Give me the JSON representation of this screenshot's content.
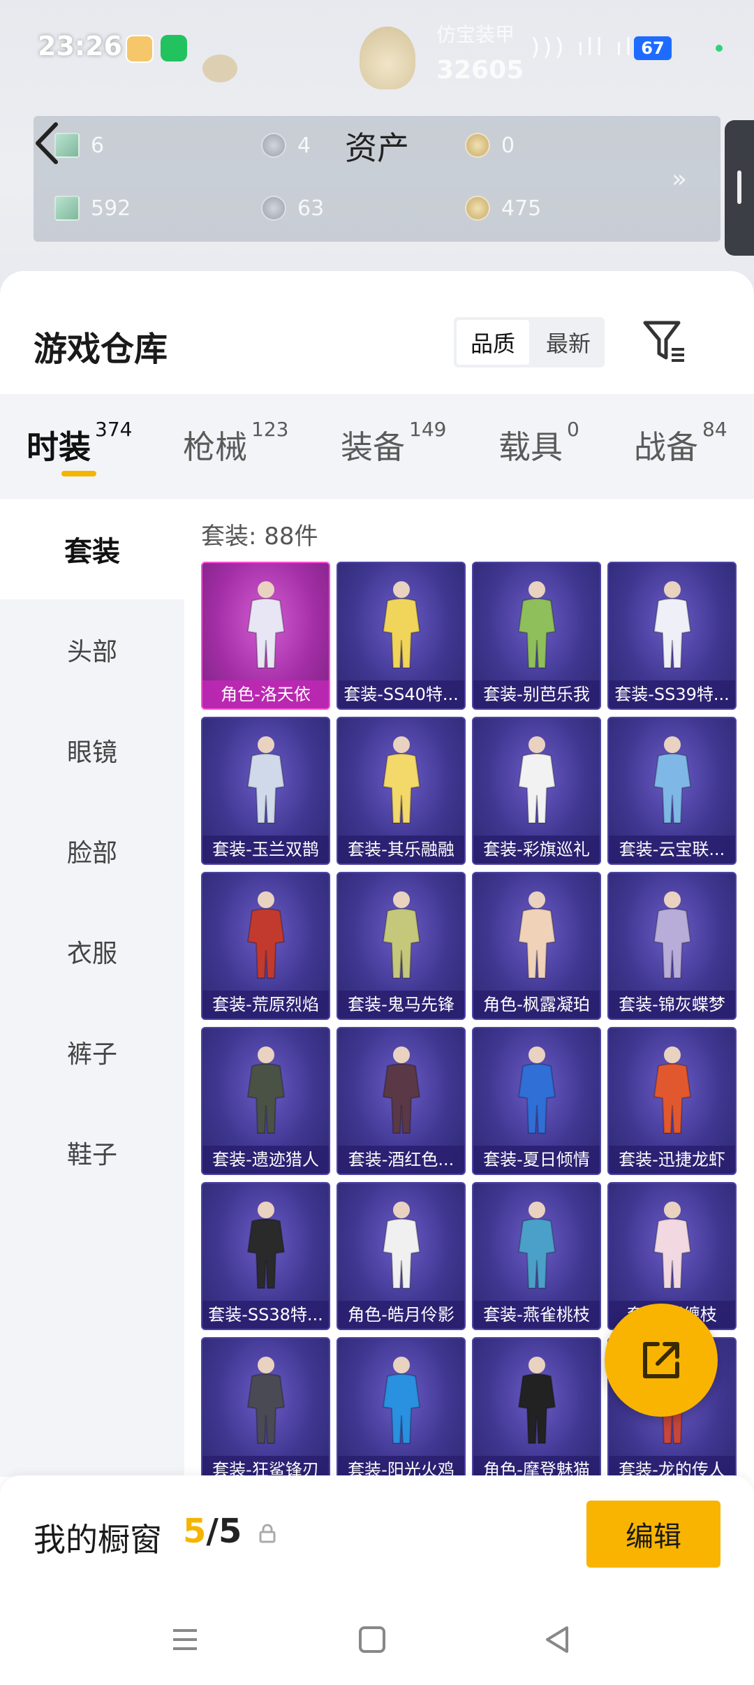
{
  "status_bar": {
    "time": "23:26",
    "battery": "67",
    "blur_title": "仿宝装甲",
    "blur_number": "32605",
    "signal": "))) ıll ıll"
  },
  "assets": {
    "title": "资产",
    "cells": [
      {
        "icon": "card-icon",
        "value": "6"
      },
      {
        "icon": "coin-silver-icon",
        "value": "4"
      },
      {
        "icon": "coin-gold-icon",
        "value": "0"
      },
      {
        "icon": "ticket-icon",
        "value": "592"
      },
      {
        "icon": "coin-silver-icon",
        "value": "63"
      },
      {
        "icon": "coin-gold-icon",
        "value": "475"
      }
    ],
    "more": "»"
  },
  "warehouse": {
    "title": "游戏仓库",
    "sort": {
      "quality": "品质",
      "newest": "最新"
    }
  },
  "tabs": [
    {
      "label": "时装",
      "count": "374"
    },
    {
      "label": "枪械",
      "count": "123"
    },
    {
      "label": "装备",
      "count": "149"
    },
    {
      "label": "载具",
      "count": "0"
    },
    {
      "label": "战备",
      "count": "84"
    }
  ],
  "side_nav": [
    "套装",
    "头部",
    "眼镜",
    "脸部",
    "衣服",
    "裤子",
    "鞋子"
  ],
  "count_label": "套装: 88件",
  "items": [
    "角色-洛天依",
    "套装-SS40特...",
    "套装-别芭乐我",
    "套装-SS39特...",
    "套装-玉兰双鹊",
    "套装-其乐融融",
    "套装-彩旗巡礼",
    "套装-云宝联...",
    "套装-荒原烈焰",
    "套装-鬼马先锋",
    "角色-枫露凝珀",
    "套装-锦灰蝶梦",
    "套装-遗迹猎人",
    "套装-酒红色...",
    "套装-夏日倾情",
    "套装-迅捷龙虾",
    "套装-SS38特...",
    "角色-皓月伶影",
    "套装-燕雀桃枝",
    "套装-彩缠枝",
    "套装-狂鲨锋刃",
    "套装-阳光火鸡",
    "角色-摩登魅猫",
    "套装-龙的传人"
  ],
  "colors": {
    "accent": "#f8b400",
    "card_purple": "#3f3690",
    "card_pink": "#a32ea6"
  },
  "showcase": {
    "label": "我的橱窗",
    "current": "5",
    "separator": "/",
    "total": "5",
    "edit": "编辑"
  }
}
